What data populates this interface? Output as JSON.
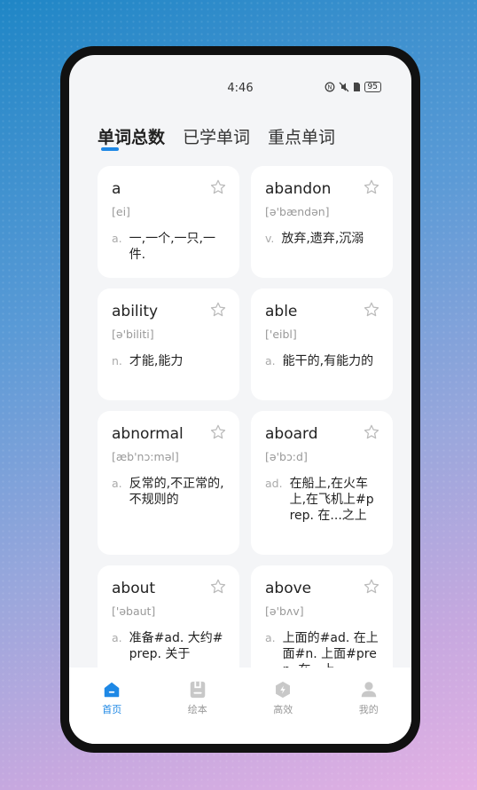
{
  "status": {
    "time": "4:46",
    "battery": "95"
  },
  "tabs": [
    {
      "label": "单词总数",
      "active": true
    },
    {
      "label": "已学单词",
      "active": false
    },
    {
      "label": "重点单词",
      "active": false
    }
  ],
  "words": [
    {
      "word": "a",
      "phonetic": "[ei]",
      "pos": "a.",
      "def": "一,一个,一只,一件."
    },
    {
      "word": "abandon",
      "phonetic": "[ə'bændən]",
      "pos": "v.",
      "def": "放弃,遗弃,沉溺"
    },
    {
      "word": "ability",
      "phonetic": "[ə'biliti]",
      "pos": "n.",
      "def": "才能,能力"
    },
    {
      "word": "able",
      "phonetic": "['eibl]",
      "pos": "a.",
      "def": "能干的,有能力的"
    },
    {
      "word": "abnormal",
      "phonetic": "[æb'nɔ:məl]",
      "pos": "a.",
      "def": "反常的,不正常的,不规则的"
    },
    {
      "word": "aboard",
      "phonetic": "[ə'bɔ:d]",
      "pos": "ad.",
      "def": "在船上,在火车上,在飞机上#prep. 在...之上"
    },
    {
      "word": "about",
      "phonetic": "['əbaut]",
      "pos": "a.",
      "def": "准备#ad. 大约#prep. 关于"
    },
    {
      "word": "above",
      "phonetic": "[ə'bʌv]",
      "pos": "a.",
      "def": "上面的#ad. 在上面#n. 上面#prep. 在...上"
    }
  ],
  "nav": [
    {
      "label": "首页",
      "icon": "home-icon",
      "active": true
    },
    {
      "label": "绘本",
      "icon": "picture-book-icon",
      "active": false
    },
    {
      "label": "高效",
      "icon": "efficiency-icon",
      "active": false
    },
    {
      "label": "我的",
      "icon": "profile-icon",
      "active": false
    }
  ],
  "colors": {
    "accent": "#1e88e5",
    "inactive": "#c8c8c8"
  }
}
